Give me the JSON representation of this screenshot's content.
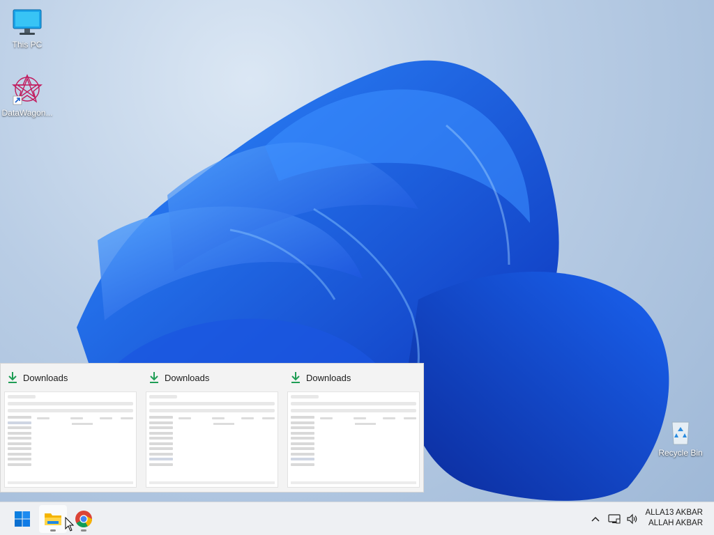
{
  "desktop": {
    "icons": [
      {
        "label": "This PC",
        "icon": "monitor-icon"
      },
      {
        "label": "DataWagon...",
        "icon": "datawagon-shortcut-icon"
      },
      {
        "label": "Recycle Bin",
        "icon": "recycle-bin-icon"
      }
    ]
  },
  "thumbnails": [
    {
      "title": "Downloads",
      "icon": "download-arrow-icon"
    },
    {
      "title": "Downloads",
      "icon": "download-arrow-icon"
    },
    {
      "title": "Downloads",
      "icon": "download-arrow-icon"
    }
  ],
  "taskbar": {
    "apps": [
      {
        "name": "Start",
        "icon": "windows-start-icon"
      },
      {
        "name": "File Explorer",
        "icon": "file-explorer-icon",
        "active": true
      },
      {
        "name": "Google Chrome",
        "icon": "chrome-icon"
      }
    ],
    "tray": {
      "overflow_icon": "chevron-up-icon",
      "network_icon": "network-icon",
      "volume_icon": "speaker-icon"
    },
    "clock": {
      "line1": "ALLA13 AKBAR",
      "line2": "ALLAH AKBAR"
    }
  },
  "colors": {
    "accent": "#0067c0",
    "download_green": "#1f9d55",
    "bloom_blue": "#1a5ee6"
  }
}
